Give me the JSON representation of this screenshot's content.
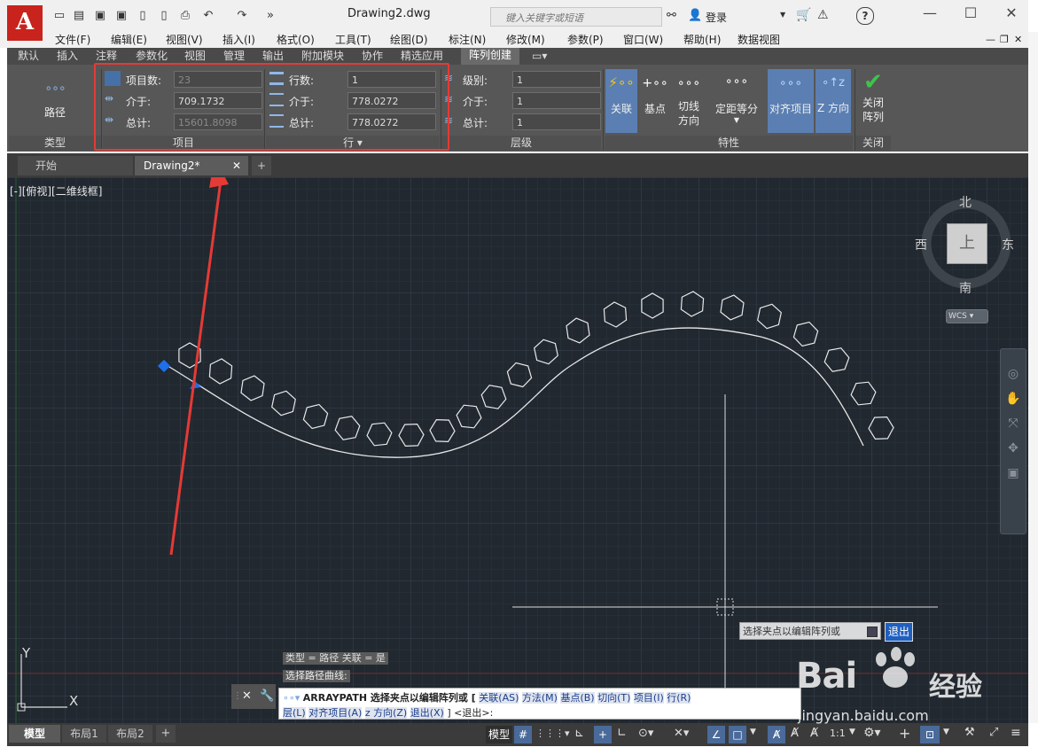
{
  "app": {
    "logo_letter": "A",
    "doc_title": "Drawing2.dwg",
    "search_placeholder": "键入关键字或短语",
    "login": "登录",
    "help": "?"
  },
  "menubar": [
    "文件(F)",
    "编辑(E)",
    "视图(V)",
    "插入(I)",
    "格式(O)",
    "工具(T)",
    "绘图(D)",
    "标注(N)",
    "修改(M)",
    "参数(P)",
    "窗口(W)",
    "帮助(H)",
    "数据视图"
  ],
  "ribbon_tabs": [
    "默认",
    "插入",
    "注释",
    "参数化",
    "视图",
    "管理",
    "输出",
    "附加模块",
    "协作",
    "精选应用"
  ],
  "ribbon_active_tab": "阵列创建",
  "ribbon": {
    "type_panel": {
      "button": "路径",
      "title": "类型"
    },
    "items_panel": {
      "title": "项目",
      "count_label": "项目数:",
      "count_value": "23",
      "between_label": "介于:",
      "between_value": "709.1732",
      "total_label": "总计:",
      "total_value": "15601.8098"
    },
    "rows_panel": {
      "title": "行 ▾",
      "rows_label": "行数:",
      "rows_value": "1",
      "between_label": "介于:",
      "between_value": "778.0272",
      "total_label": "总计:",
      "total_value": "778.0272"
    },
    "levels_panel": {
      "title": "层级",
      "levels_label": "级别:",
      "levels_value": "1",
      "between_label": "介于:",
      "between_value": "1",
      "total_label": "总计:",
      "total_value": "1"
    },
    "props_panel": {
      "title": "特性",
      "associative": "关联",
      "base_point": "基点",
      "tangent": "切线\n方向",
      "measure": "定距等分",
      "align_items": "对齐项目",
      "z_direction": "Z 方向"
    },
    "close_panel": {
      "title": "关闭",
      "button": "关闭\n阵列"
    }
  },
  "doc_tabs": [
    "开始",
    "Drawing2*"
  ],
  "viewport_label": "[-][俯视][二维线框]",
  "viewcube": {
    "north": "北",
    "south": "南",
    "east": "东",
    "west": "西",
    "top": "上",
    "wcs": "WCS"
  },
  "ucs": {
    "x": "X",
    "y": "Y"
  },
  "prompt_popup": {
    "text": "选择夹点以编辑阵列或",
    "option": "退出"
  },
  "history": [
    "类型 = 路径  关联 = 是",
    "选择路径曲线:"
  ],
  "command": {
    "line1_cmd": "ARRAYPATH 选择夹点以编辑阵列或 [",
    "options1": [
      "关联(AS)",
      "方法(M)",
      "基点(B)",
      "切向(T)",
      "项目(I)",
      "行(R)"
    ],
    "options2": [
      "层(L)",
      "对齐项目(A)",
      "z 方向(Z)",
      "退出(X)"
    ],
    "line2_tail": "] <退出>:"
  },
  "layout_tabs": [
    "模型",
    "布局1",
    "布局2"
  ],
  "status_model": "模型",
  "status_scale": "1:1",
  "watermark": {
    "main": "Bai",
    "sub": "经验",
    "url": "jingyan.baidu.com"
  },
  "colors": {
    "autocad_red": "#c8231d",
    "highlight": "#e53a35",
    "active_blue": "#5b7fb2",
    "canvas": "#212830"
  }
}
